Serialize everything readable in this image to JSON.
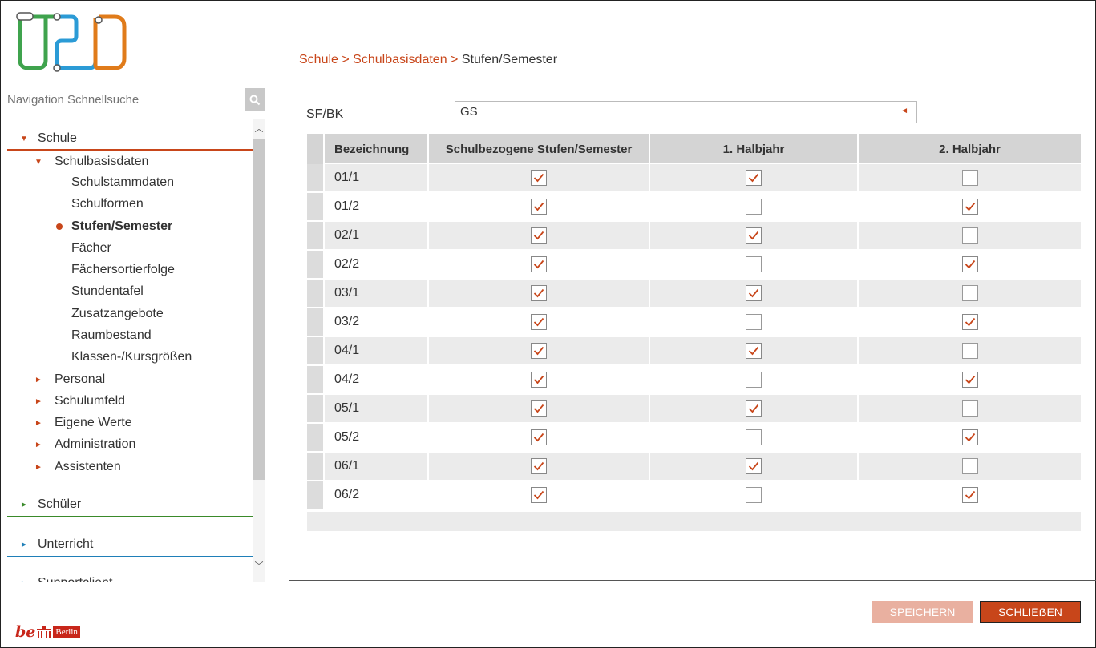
{
  "logo": {
    "name": "USO",
    "colors": [
      "#3fa34d",
      "#2b9bd6",
      "#e07b1a"
    ]
  },
  "search": {
    "placeholder": "Navigation Schnellsuche"
  },
  "nav": {
    "sections": [
      {
        "label": "Schule",
        "color": "#c8461a",
        "expanded": true
      },
      {
        "label": "Schüler",
        "color": "#3a8a2a",
        "expanded": false
      },
      {
        "label": "Unterricht",
        "color": "#1f7fb8",
        "expanded": false
      },
      {
        "label": "Supportclient",
        "expanded": false
      }
    ],
    "schule_children": {
      "group": "Schulbasisdaten",
      "items": [
        "Schulstammdaten",
        "Schulformen",
        "Stufen/Semester",
        "Fächer",
        "Fächersortierfolge",
        "Stundentafel",
        "Zusatzangebote",
        "Raumbestand",
        "Klassen-/Kursgrößen"
      ],
      "active": "Stufen/Semester",
      "others": [
        "Personal",
        "Schulumfeld",
        "Eigene Werte",
        "Administration",
        "Assistenten"
      ]
    }
  },
  "breadcrumb": {
    "l1": "Schule",
    "sep": ">",
    "l2": "Schulbasisdaten",
    "current": "Stufen/Semester"
  },
  "filter": {
    "label": "SF/BK",
    "value": "GS"
  },
  "table": {
    "headers": [
      "Bezeichnung",
      "Schulbezogene Stufen/Semester",
      "1. Halbjahr",
      "2. Halbjahr"
    ],
    "rows": [
      {
        "name": "01/1",
        "stufe": true,
        "h1": true,
        "h2": false
      },
      {
        "name": "01/2",
        "stufe": true,
        "h1": false,
        "h2": true
      },
      {
        "name": "02/1",
        "stufe": true,
        "h1": true,
        "h2": false
      },
      {
        "name": "02/2",
        "stufe": true,
        "h1": false,
        "h2": true
      },
      {
        "name": "03/1",
        "stufe": true,
        "h1": true,
        "h2": false
      },
      {
        "name": "03/2",
        "stufe": true,
        "h1": false,
        "h2": true
      },
      {
        "name": "04/1",
        "stufe": true,
        "h1": true,
        "h2": false
      },
      {
        "name": "04/2",
        "stufe": true,
        "h1": false,
        "h2": true
      },
      {
        "name": "05/1",
        "stufe": true,
        "h1": true,
        "h2": false
      },
      {
        "name": "05/2",
        "stufe": true,
        "h1": false,
        "h2": true
      },
      {
        "name": "06/1",
        "stufe": true,
        "h1": true,
        "h2": false
      },
      {
        "name": "06/2",
        "stufe": true,
        "h1": false,
        "h2": true
      }
    ]
  },
  "buttons": {
    "save": "SPEICHERN",
    "close": "SCHLIEẞEN"
  },
  "footer_logo": {
    "be": "be",
    "badge": "Berlin"
  },
  "colors": {
    "accent": "#c8461a",
    "accent_light": "#e9b0a0",
    "check": "#c8461a"
  }
}
